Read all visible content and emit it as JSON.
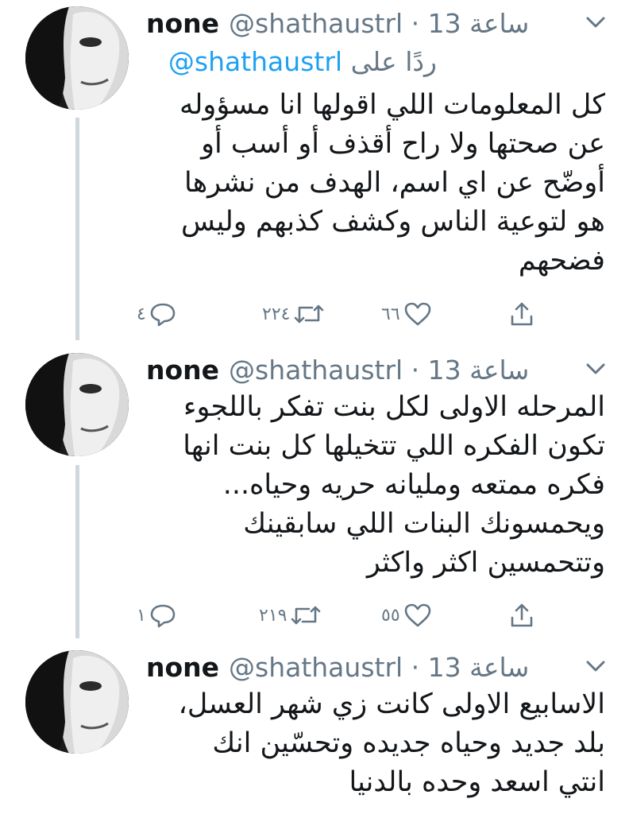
{
  "tweets": [
    {
      "display_name": "none",
      "handle_time": "@shathaustrl · 13 ساعة",
      "reply_prefix": "ردًا على",
      "reply_mention": "@shathaustrl",
      "text": "كل المعلومات اللي اقولها انا مسؤوله\nعن صحتها ولا راح أقذف أو أسب أو\nأوضّح عن اي اسم، الهدف من نشرها\nهو لتوعية الناس وكشف كذبهم وليس\nفضحهم",
      "replies": "٤",
      "retweets": "٢٢٤",
      "likes": "٦٦"
    },
    {
      "display_name": "none",
      "handle_time": "@shathaustrl · 13 ساعة",
      "text": "المرحله الاولى لكل بنت تفكر باللجوء\nتكون الفكره اللي تتخيلها كل بنت انها\nفكره ممتعه ومليانه حريه وحياه...\nويحمسونك البنات اللي سابقينك\nوتتحمسين اكثر واكثر",
      "replies": "١",
      "retweets": "٢١٩",
      "likes": "٥٥"
    },
    {
      "display_name": "none",
      "handle_time": "@shathaustrl · 13 ساعة",
      "text": "الاسابيع الاولى كانت زي شهر العسل،\nبلد جديد وحياه جديده وتحسّين انك\nانتي اسعد وحده بالدنيا"
    }
  ],
  "icons": {
    "reply": "reply-icon",
    "retweet": "retweet-icon",
    "like": "heart-icon",
    "share": "share-icon",
    "more": "chevron-down-icon"
  },
  "colors": {
    "text": "#14171a",
    "muted": "#657786",
    "link": "#1da1f2",
    "thread_line": "#cfd8dc"
  }
}
